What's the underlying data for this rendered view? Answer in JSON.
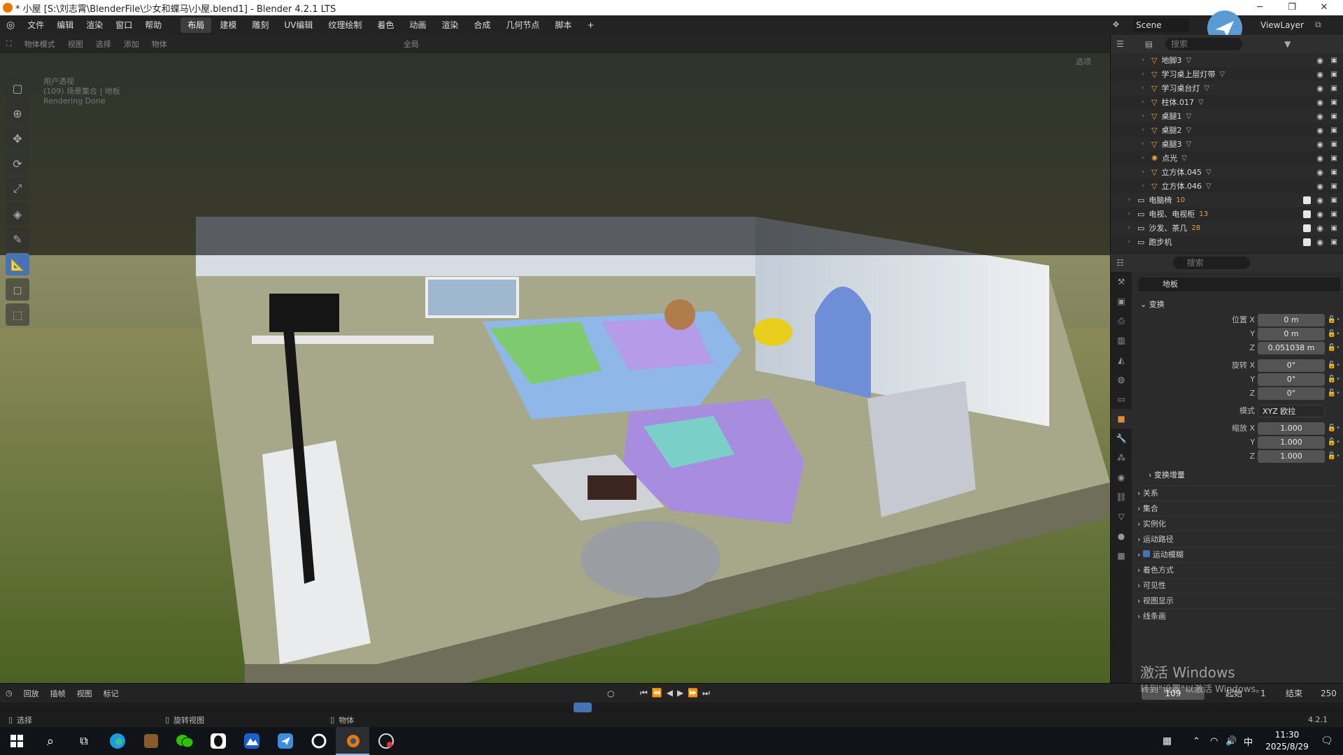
{
  "titlebar": {
    "title": "* 小屋 [S:\\刘志霄\\BlenderFile\\少女和蝶马\\小屋.blend1] - Blender 4.2.1 LTS",
    "minimize": "─",
    "maximize": "❐",
    "close": "✕"
  },
  "menubar": {
    "menus": [
      "文件",
      "编辑",
      "渲染",
      "窗口",
      "帮助"
    ],
    "workspaces": [
      "布局",
      "建模",
      "雕刻",
      "UV编辑",
      "纹理绘制",
      "着色",
      "动画",
      "渲染",
      "合成",
      "几何节点",
      "脚本"
    ],
    "add_tab": "+",
    "scene_label": "Scene",
    "viewlayer_label": "ViewLayer"
  },
  "viewport_header": {
    "mode": "物体模式",
    "menus": [
      "视图",
      "选择",
      "添加",
      "物体"
    ],
    "transform": "全局",
    "options": "选项"
  },
  "viewport_info": [
    "用户透视",
    "(109) 场景集合 | 地板",
    "Rendering Done"
  ],
  "outliner": {
    "search_placeholder": "搜索",
    "rows": [
      {
        "name": "地脚3",
        "icon": "mesh",
        "child": true
      },
      {
        "name": "学习桌上层灯带",
        "icon": "mesh",
        "child": true
      },
      {
        "name": "学习桌台灯",
        "icon": "mesh",
        "child": true
      },
      {
        "name": "柱体.017",
        "icon": "mesh",
        "child": true
      },
      {
        "name": "桌腿1",
        "icon": "mesh",
        "child": true
      },
      {
        "name": "桌腿2",
        "icon": "mesh",
        "child": true
      },
      {
        "name": "桌腿3",
        "icon": "mesh",
        "child": true
      },
      {
        "name": "点光",
        "icon": "light",
        "child": true
      },
      {
        "name": "立方体.045",
        "icon": "mesh",
        "child": true
      },
      {
        "name": "立方体.046",
        "icon": "mesh",
        "child": true
      },
      {
        "name": "电脑椅",
        "icon": "collection",
        "count": "10",
        "child": false
      },
      {
        "name": "电视、电视柜",
        "icon": "collection",
        "count": "13",
        "child": false
      },
      {
        "name": "沙发、茶几",
        "icon": "collection",
        "count": "28",
        "child": false
      },
      {
        "name": "跑步机",
        "icon": "collection",
        "count": "",
        "child": false
      }
    ]
  },
  "properties": {
    "search_placeholder": "搜索",
    "object_name": "地板",
    "transform_title": "变换",
    "location": {
      "label": "位置 X",
      "x": "0 m",
      "y": "0 m",
      "z": "0.051038 m"
    },
    "rotation": {
      "label": "旋转 X",
      "x": "0°",
      "y": "0°",
      "z": "0°"
    },
    "mode_label": "模式",
    "mode_value": "XYZ 欧拉",
    "scale": {
      "label": "缩放 X",
      "x": "1.000",
      "y": "1.000",
      "z": "1.000"
    },
    "axis_y": "Y",
    "axis_z": "Z",
    "delta_transform": "变换增量",
    "sections": [
      "关系",
      "集合",
      "实例化",
      "运动路径",
      "运动模糊",
      "着色方式",
      "可见性",
      "视图显示",
      "线条画"
    ]
  },
  "timeline": {
    "menus": [
      "回放",
      "插帧",
      "视图",
      "标记"
    ],
    "current_frame": "109",
    "start_label": "起始",
    "start": "1",
    "end_label": "结束",
    "end": "250"
  },
  "statusbar": {
    "select": "选择",
    "rotate_view": "旋转视图",
    "object": "物体",
    "version": "4.2.1"
  },
  "watermark": {
    "line1": "激活 Windows",
    "line2": "转到\"设置\"以激活 Windows。"
  },
  "taskbar": {
    "time": "11:30",
    "date": "2025/8/29",
    "ime": "中"
  },
  "colors": {
    "accent": "#4772b3",
    "blender_orange": "#ea7600",
    "mesh_icon": "#e8a33a",
    "data_green": "#7ec36c"
  }
}
